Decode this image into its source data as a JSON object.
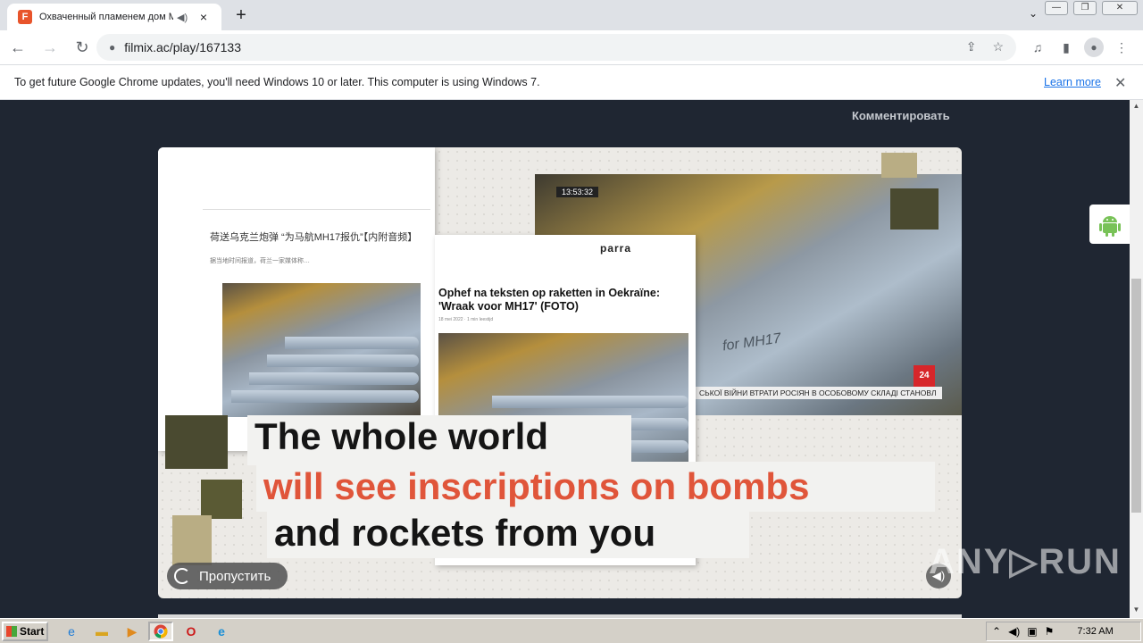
{
  "browser": {
    "tab": {
      "favicon": "F",
      "title": "Охваченный пламенем дом Мо",
      "audio_icon": "speaker-icon",
      "close": "×"
    },
    "new_tab": "+",
    "tab_list": "⌄",
    "window_controls": [
      "—",
      "❐",
      "✕"
    ],
    "back": "←",
    "forward": "→",
    "reload": "↻",
    "lock": "🔒",
    "url": "filmix.ac/play/167133",
    "share_icon": "⇪",
    "bookmark_icon": "☆",
    "media_icon": "♫",
    "sidepanel_icon": "▮",
    "profile_icon": "●",
    "menu_icon": "⋮"
  },
  "infobar": {
    "message": "To get future Google Chrome updates, you'll need Windows 10 or later. This computer is using Windows 7.",
    "link": "Learn more",
    "close": "✕"
  },
  "page": {
    "comment_link": "Комментировать",
    "video": {
      "cn_headline": "荷送乌克兰炮弹 “为马航MH17报仇”【内附音频】",
      "cn_subtext": "据当地时间报道，荷兰一家媒体称…",
      "parra_logo": "parra",
      "nl_headline": "Ophef na teksten op raketten in Oekraïne: 'Wraak voor MH17' (FOTO)",
      "nl_meta": "18 mei 2022 · 1 min leestijd",
      "timestamp": "13:53:32",
      "ticker": "СЬКОЇ ВІЙНИ ВТРАТИ РОСІЯН В ОСОБОВОМУ СКЛАДІ СТАНОВЛ",
      "channel_badge": "24",
      "shell_inscription": "for MH17",
      "caption_line1": "The whole world",
      "caption_line2": "will see inscriptions on bombs",
      "caption_line3": "and rockets from you",
      "skip_button": "Пропустить",
      "volume_icon": "speaker-icon"
    },
    "android_icon": "android-icon"
  },
  "watermark": "ANY▷RUN",
  "colors": {
    "page_bg": "#1f2632",
    "caption_accent": "#e0553a",
    "link": "#1a73e8"
  },
  "taskbar": {
    "start": "Start",
    "clock": "7:32 AM"
  }
}
